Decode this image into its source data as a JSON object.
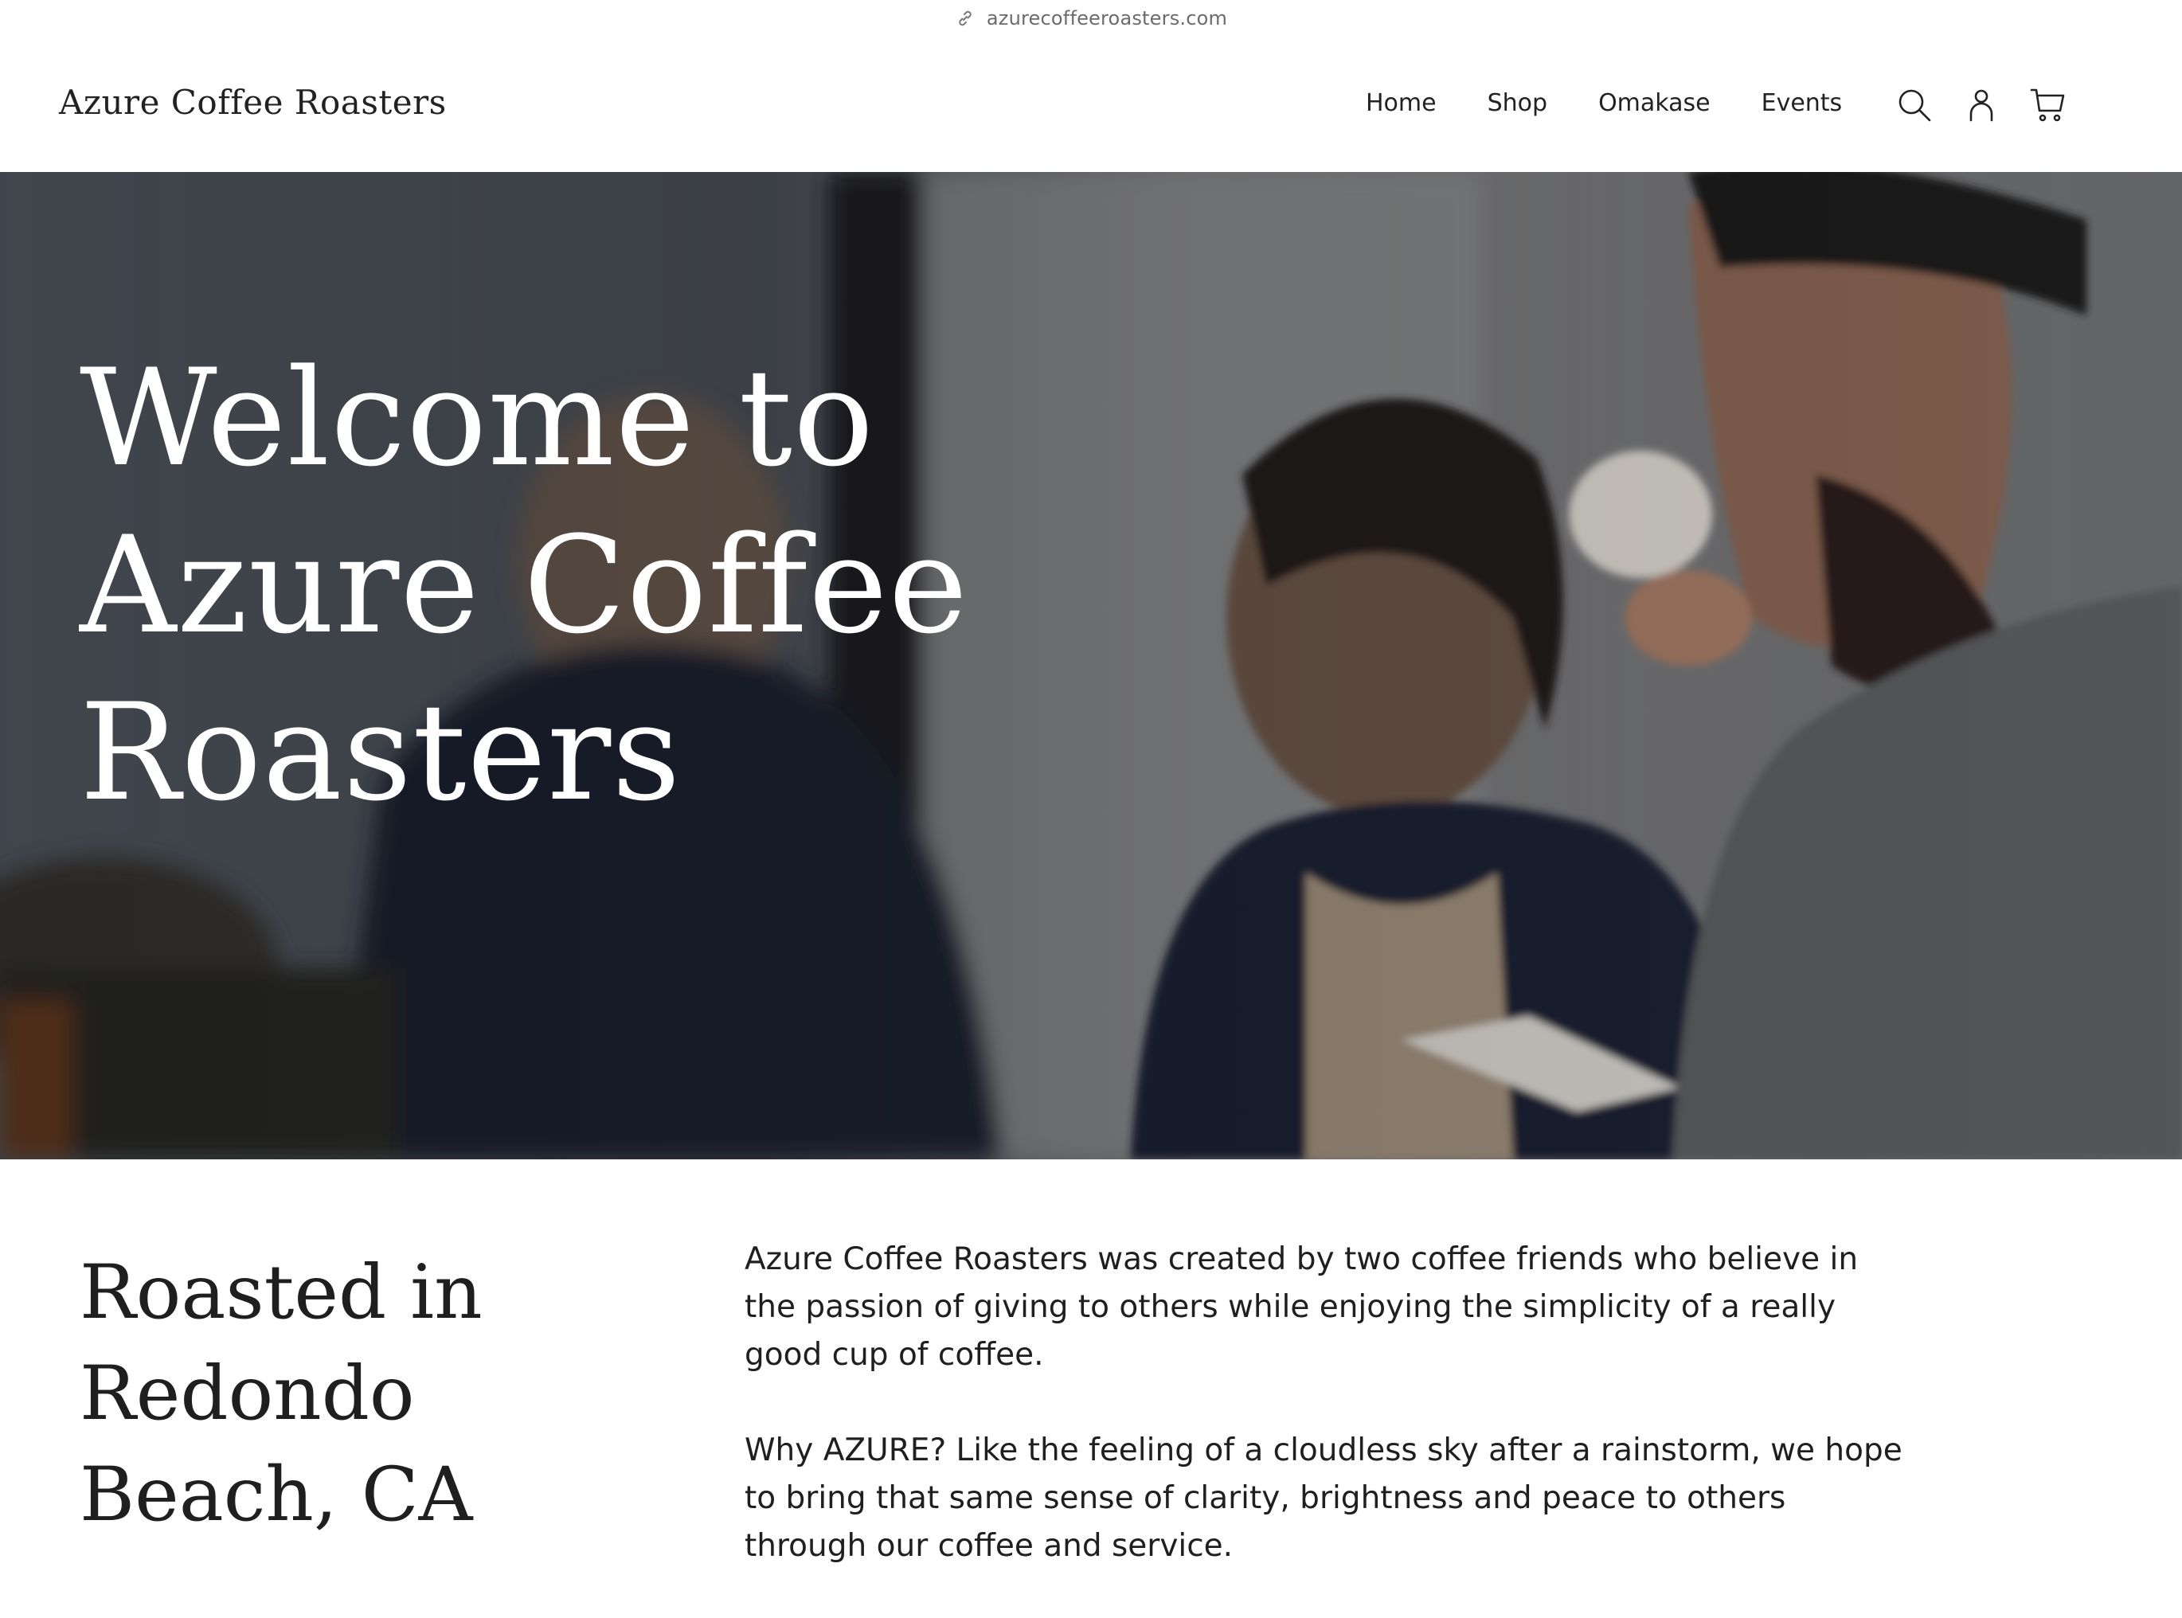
{
  "browser": {
    "url": "azurecoffeeroasters.com",
    "link_icon": "link-icon"
  },
  "header": {
    "brand": "Azure Coffee Roasters",
    "nav": [
      {
        "label": "Home"
      },
      {
        "label": "Shop"
      },
      {
        "label": "Omakase"
      },
      {
        "label": "Events"
      }
    ],
    "icons": [
      "search-icon",
      "account-icon",
      "cart-icon"
    ]
  },
  "hero": {
    "title": "Welcome to Azure Coffee Roasters",
    "image": "photo of people tasting coffee in a roastery"
  },
  "intro": {
    "heading": "Roasted in Redondo Beach, CA",
    "paragraphs": [
      "Azure Coffee Roasters was created by two coffee friends who believe in the passion of giving to others while enjoying the simplicity of a really good cup of coffee.",
      "Why AZURE? Like the feeling of a cloudless sky after a rainstorm, we hope to bring that same sense of clarity, brightness and peace to others through our coffee and service."
    ]
  },
  "colors": {
    "text": "#1f1f1f",
    "hero_text": "#ffffff",
    "url_text": "#6b6b6b"
  }
}
